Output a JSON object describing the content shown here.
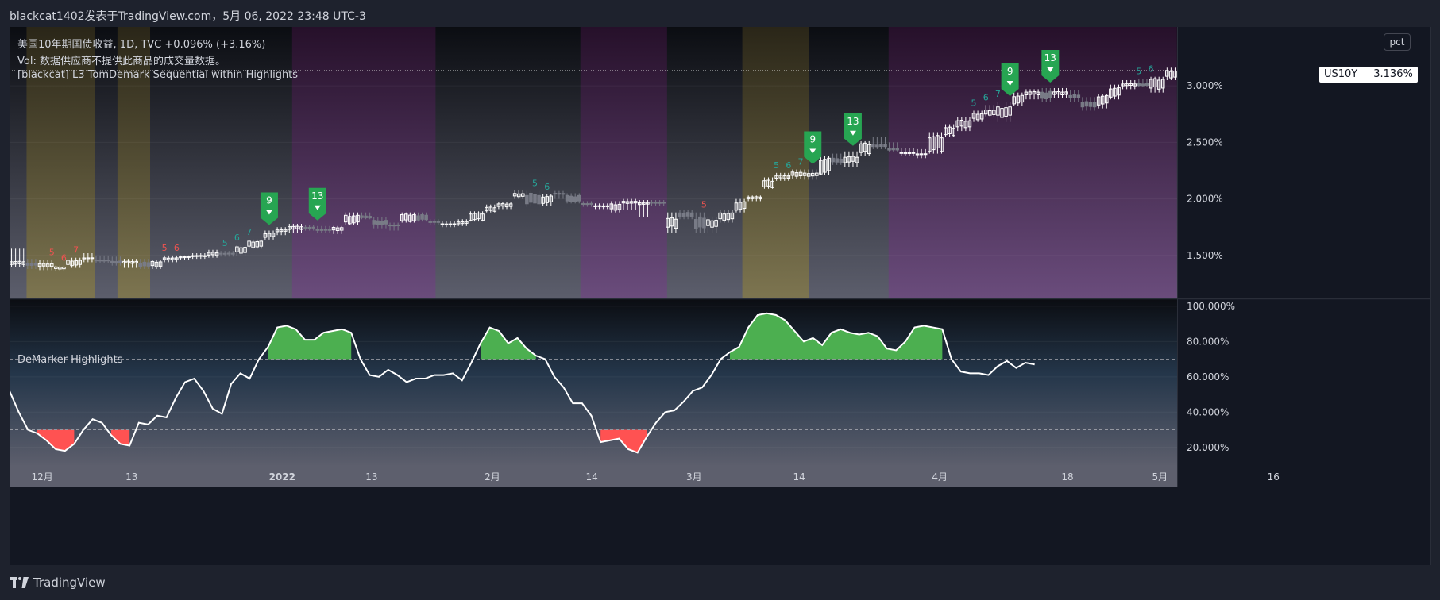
{
  "header": {
    "publisher": "blackcat1402发表于TradingView.com，5月 06, 2022 23:48 UTC-3"
  },
  "legend": {
    "symbol": "美国10年期国债收益, 1D, TVC",
    "change": "+0.096% (+3.16%)",
    "vol": "Vol: 数据供应商不提供此商品的成交量数据。",
    "indicator": "[blackcat] L3 TomDemark Sequential within Highlights"
  },
  "pct_button": "pct",
  "last_price": {
    "ticker": "US10Y",
    "value": "3.136%"
  },
  "sub_pane": {
    "title": "DeMarker Highlights"
  },
  "footer": {
    "brand": "TradingView"
  },
  "colors": {
    "bull": "#ffffff",
    "bear": "#787b86",
    "ob_fill": "#4caf50",
    "os_fill": "#ff5252",
    "sell_zone": "#6a4c7c",
    "buy_zone": "#7d7550",
    "count_up": "#26a69a",
    "count_dn": "#ef5350",
    "signal": "#27a552"
  },
  "chart_data": [
    {
      "type": "candlestick",
      "title": "美国10年期国债收益",
      "ylabel": "%",
      "y_ticks": [
        "1.500%",
        "2.000%",
        "2.500%",
        "3.000%"
      ],
      "ylim": [
        1.12,
        3.52
      ],
      "x_ticks": [
        "12月",
        "13",
        "2022",
        "13",
        "2月",
        "14",
        "3月",
        "14",
        "4月",
        "18",
        "5月",
        "16"
      ],
      "last_value": 3.136,
      "ohlc_every_3rd_bar": [
        [
          1.42,
          1.56,
          1.4,
          1.45
        ],
        [
          1.43,
          1.47,
          1.38,
          1.41
        ],
        [
          1.4,
          1.46,
          1.37,
          1.43
        ],
        [
          1.38,
          1.41,
          1.36,
          1.4
        ],
        [
          1.41,
          1.48,
          1.39,
          1.46
        ],
        [
          1.47,
          1.52,
          1.44,
          1.48
        ],
        [
          1.46,
          1.5,
          1.43,
          1.45
        ],
        [
          1.45,
          1.49,
          1.41,
          1.43
        ],
        [
          1.43,
          1.47,
          1.39,
          1.45
        ],
        [
          1.44,
          1.47,
          1.38,
          1.4
        ],
        [
          1.4,
          1.46,
          1.38,
          1.45
        ],
        [
          1.46,
          1.5,
          1.44,
          1.48
        ],
        [
          1.48,
          1.5,
          1.46,
          1.49
        ],
        [
          1.49,
          1.52,
          1.47,
          1.5
        ],
        [
          1.5,
          1.55,
          1.48,
          1.53
        ],
        [
          1.52,
          1.54,
          1.49,
          1.51
        ],
        [
          1.52,
          1.59,
          1.5,
          1.58
        ],
        [
          1.57,
          1.64,
          1.56,
          1.63
        ],
        [
          1.66,
          1.72,
          1.64,
          1.7
        ],
        [
          1.71,
          1.75,
          1.68,
          1.73
        ],
        [
          1.73,
          1.78,
          1.7,
          1.76
        ],
        [
          1.75,
          1.77,
          1.72,
          1.74
        ],
        [
          1.73,
          1.76,
          1.7,
          1.72
        ],
        [
          1.72,
          1.76,
          1.69,
          1.75
        ],
        [
          1.78,
          1.88,
          1.77,
          1.86
        ],
        [
          1.85,
          1.88,
          1.82,
          1.83
        ],
        [
          1.81,
          1.84,
          1.74,
          1.77
        ],
        [
          1.77,
          1.79,
          1.72,
          1.76
        ],
        [
          1.8,
          1.88,
          1.79,
          1.87
        ],
        [
          1.86,
          1.88,
          1.8,
          1.81
        ],
        [
          1.8,
          1.82,
          1.77,
          1.79
        ],
        [
          1.77,
          1.8,
          1.75,
          1.78
        ],
        [
          1.78,
          1.82,
          1.76,
          1.8
        ],
        [
          1.81,
          1.89,
          1.8,
          1.88
        ],
        [
          1.89,
          1.95,
          1.88,
          1.93
        ],
        [
          1.93,
          1.97,
          1.91,
          1.96
        ],
        [
          2.02,
          2.08,
          2.0,
          2.05
        ],
        [
          2.05,
          2.07,
          1.93,
          1.95
        ],
        [
          1.96,
          2.04,
          1.94,
          2.03
        ],
        [
          2.05,
          2.07,
          2.0,
          2.04
        ],
        [
          2.03,
          2.05,
          1.96,
          1.97
        ],
        [
          1.96,
          1.98,
          1.93,
          1.95
        ],
        [
          1.93,
          1.96,
          1.91,
          1.94
        ],
        [
          1.9,
          1.98,
          1.88,
          1.96
        ],
        [
          1.96,
          2.0,
          1.9,
          1.98
        ],
        [
          1.95,
          1.99,
          1.84,
          1.97
        ],
        [
          1.97,
          1.99,
          1.94,
          1.96
        ],
        [
          1.74,
          1.88,
          1.7,
          1.84
        ],
        [
          1.88,
          1.9,
          1.82,
          1.84
        ],
        [
          1.84,
          1.88,
          1.7,
          1.73
        ],
        [
          1.75,
          1.84,
          1.7,
          1.82
        ],
        [
          1.81,
          1.9,
          1.79,
          1.88
        ],
        [
          1.9,
          2.0,
          1.88,
          1.98
        ],
        [
          2.0,
          2.03,
          1.98,
          2.02
        ],
        [
          2.1,
          2.19,
          2.09,
          2.17
        ],
        [
          2.18,
          2.23,
          2.16,
          2.21
        ],
        [
          2.2,
          2.26,
          2.18,
          2.24
        ],
        [
          2.2,
          2.26,
          2.17,
          2.23
        ],
        [
          2.22,
          2.38,
          2.21,
          2.37
        ],
        [
          2.36,
          2.4,
          2.3,
          2.32
        ],
        [
          2.32,
          2.42,
          2.28,
          2.38
        ],
        [
          2.4,
          2.51,
          2.38,
          2.5
        ],
        [
          2.48,
          2.55,
          2.44,
          2.46
        ],
        [
          2.45,
          2.5,
          2.42,
          2.43
        ],
        [
          2.4,
          2.45,
          2.38,
          2.41
        ],
        [
          2.39,
          2.44,
          2.36,
          2.4
        ],
        [
          2.42,
          2.59,
          2.4,
          2.57
        ],
        [
          2.56,
          2.66,
          2.55,
          2.64
        ],
        [
          2.63,
          2.72,
          2.6,
          2.7
        ],
        [
          2.7,
          2.78,
          2.68,
          2.76
        ],
        [
          2.74,
          2.83,
          2.73,
          2.79
        ],
        [
          2.72,
          2.86,
          2.68,
          2.82
        ],
        [
          2.84,
          2.94,
          2.82,
          2.92
        ],
        [
          2.92,
          2.97,
          2.88,
          2.95
        ],
        [
          2.95,
          2.98,
          2.86,
          2.88
        ],
        [
          2.92,
          2.98,
          2.89,
          2.95
        ],
        [
          2.92,
          2.96,
          2.86,
          2.89
        ],
        [
          2.86,
          2.9,
          2.78,
          2.81
        ],
        [
          2.83,
          2.93,
          2.8,
          2.92
        ],
        [
          2.9,
          3.01,
          2.88,
          2.99
        ],
        [
          3.0,
          3.05,
          2.97,
          3.02
        ],
        [
          3.02,
          3.06,
          2.99,
          3.0
        ],
        [
          2.97,
          3.08,
          2.94,
          3.07
        ],
        [
          3.07,
          3.16,
          3.05,
          3.14
        ]
      ],
      "bands": [
        {
          "from": 0.012,
          "to": 0.06,
          "zone": "buy"
        },
        {
          "from": 0.076,
          "to": 0.099,
          "zone": "buy"
        },
        {
          "from": 0.199,
          "to": 0.3,
          "zone": "sell"
        },
        {
          "from": 0.402,
          "to": 0.463,
          "zone": "sell"
        },
        {
          "from": 0.516,
          "to": 0.563,
          "zone": "buy"
        },
        {
          "from": 0.619,
          "to": 0.822,
          "zone": "sell"
        },
        {
          "from": 0.862,
          "to": 0.869,
          "zone": "sell"
        }
      ],
      "signals": [
        {
          "bar": 64,
          "label": "9"
        },
        {
          "bar": 76,
          "label": "13"
        },
        {
          "bar": 199,
          "label": "9"
        },
        {
          "bar": 209,
          "label": "13"
        },
        {
          "bar": 248,
          "label": "9"
        },
        {
          "bar": 258,
          "label": "13"
        }
      ],
      "counts": [
        {
          "bar": 53,
          "label": "5",
          "dir": "up"
        },
        {
          "bar": 56,
          "label": "6",
          "dir": "up"
        },
        {
          "bar": 59,
          "label": "7",
          "dir": "up"
        },
        {
          "bar": 10,
          "label": "5",
          "dir": "dn"
        },
        {
          "bar": 13,
          "label": "6",
          "dir": "dn"
        },
        {
          "bar": 16,
          "label": "7",
          "dir": "dn"
        },
        {
          "bar": 38,
          "label": "5",
          "dir": "dn"
        },
        {
          "bar": 41,
          "label": "6",
          "dir": "dn"
        },
        {
          "bar": 130,
          "label": "5",
          "dir": "up"
        },
        {
          "bar": 133,
          "label": "6",
          "dir": "up"
        },
        {
          "bar": 172,
          "label": "5",
          "dir": "dn"
        },
        {
          "bar": 190,
          "label": "5",
          "dir": "up"
        },
        {
          "bar": 193,
          "label": "6",
          "dir": "up"
        },
        {
          "bar": 196,
          "label": "7",
          "dir": "up"
        },
        {
          "bar": 239,
          "label": "5",
          "dir": "up"
        },
        {
          "bar": 242,
          "label": "6",
          "dir": "up"
        },
        {
          "bar": 245,
          "label": "7",
          "dir": "up"
        },
        {
          "bar": 280,
          "label": "5",
          "dir": "up"
        },
        {
          "bar": 283,
          "label": "6",
          "dir": "up"
        }
      ]
    },
    {
      "type": "line",
      "title": "DeMarker Highlights",
      "y_ticks": [
        "20.000%",
        "40.000%",
        "60.000%",
        "80.000%",
        "100.000%"
      ],
      "ylim": [
        10,
        104
      ],
      "overbought": 70,
      "oversold": 30,
      "values": [
        52,
        40,
        30,
        28,
        24,
        19,
        18,
        22,
        30,
        36,
        34,
        27,
        22,
        21,
        34,
        33,
        38,
        37,
        48,
        57,
        59,
        52,
        42,
        39,
        56,
        62,
        59,
        70,
        77,
        88,
        89,
        87,
        81,
        81,
        85,
        86,
        87,
        85,
        70,
        61,
        60,
        64,
        61,
        57,
        59,
        59,
        61,
        61,
        62,
        58,
        68,
        79,
        88,
        86,
        79,
        82,
        76,
        72,
        70,
        60,
        54,
        45,
        45,
        38,
        23,
        24,
        25,
        19,
        17,
        26,
        34,
        40,
        41,
        46,
        52,
        54,
        61,
        70,
        74,
        77,
        88,
        95,
        96,
        95,
        92,
        86,
        80,
        82,
        78,
        85,
        87,
        85,
        84,
        85,
        83,
        76,
        75,
        80,
        88,
        89,
        88,
        87,
        70,
        63,
        62,
        62,
        61,
        66,
        69,
        65,
        68,
        67
      ]
    }
  ]
}
